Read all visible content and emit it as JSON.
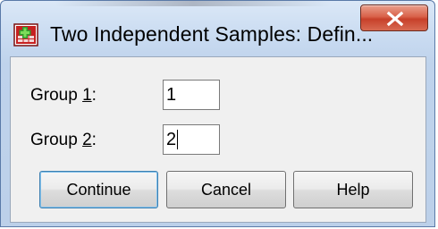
{
  "window": {
    "title": "Two Independent Samples: Defin...",
    "app_icon": "spss-dialog-icon",
    "close_icon": "close-icon"
  },
  "form": {
    "group1": {
      "label_prefix": "Group ",
      "label_accel": "1",
      "label_suffix": ":",
      "value": "1"
    },
    "group2": {
      "label_prefix": "Group ",
      "label_accel": "2",
      "label_suffix": ":",
      "value": "2"
    }
  },
  "buttons": {
    "continue": "Continue",
    "cancel": "Cancel",
    "help": "Help"
  },
  "colors": {
    "close_button": "#c7402a",
    "default_button_border": "#3c7fb1"
  }
}
